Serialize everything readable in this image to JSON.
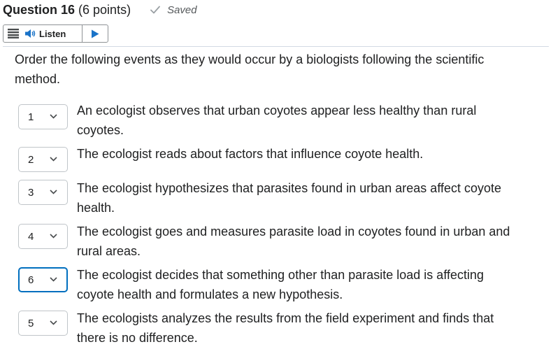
{
  "header": {
    "question_label": "Question 16",
    "points": "(6 points)",
    "status": "Saved"
  },
  "listen": {
    "label": "Listen"
  },
  "question": {
    "text": "Order the following events as they would occur by a biologists following the scientific method."
  },
  "items": [
    {
      "order": "1",
      "text": "An ecologist observes that urban coyotes appear less healthy than rural coyotes."
    },
    {
      "order": "2",
      "text": "The ecologist reads about factors that influence coyote health."
    },
    {
      "order": "3",
      "text": "The ecologist hypothesizes that  parasites found in urban areas affect coyote health."
    },
    {
      "order": "4",
      "text": "The ecologist goes and measures parasite load in coyotes found in urban and rural areas."
    },
    {
      "order": "6",
      "text": "The ecologist decides that something other than parasite load is affecting coyote health and formulates a new hypothesis.",
      "focused": true
    },
    {
      "order": "5",
      "text": "The ecologists analyzes the results from the field experiment and finds that there is no difference."
    }
  ],
  "colors": {
    "focus_border": "#006fbf",
    "text": "#202122",
    "divider": "#d3d9e3"
  }
}
